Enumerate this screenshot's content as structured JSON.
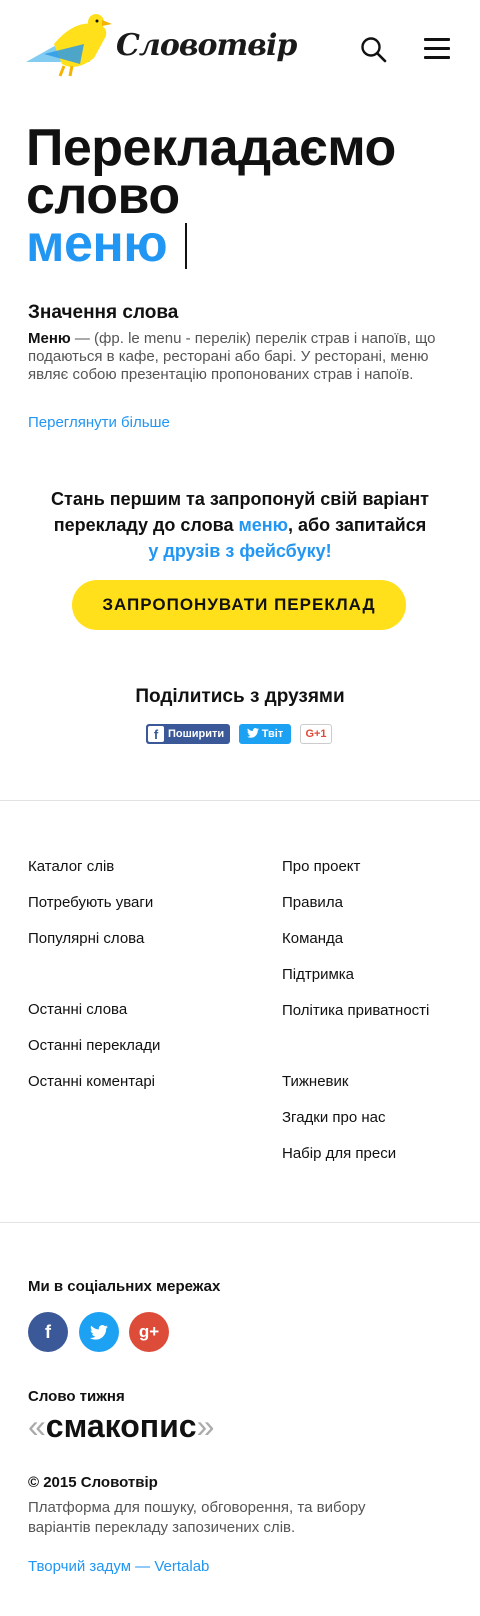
{
  "header": {
    "logo_text": "Словотвір",
    "colors": {
      "bird_blue": "#74c6f0",
      "bird_yellow": "#ffe01a",
      "bird_deep_blue": "#2e9be6"
    }
  },
  "hero": {
    "title_line1": "Перекладаємо",
    "title_line2": "слово",
    "word": "меню"
  },
  "meaning": {
    "heading": "Значення слова",
    "term": "Меню",
    "definition": " — (фр. le menu - перелік) перелік страв і напоїв, що подаються в кафе, ресторані або барі. У ресторані, меню являє собою презентацію пропонованих страв і напоїв.",
    "more_link": "Переглянути більше"
  },
  "cta": {
    "text_part1": "Стань першим та запропонуй свій варіант перекладу до слова ",
    "word": "меню",
    "text_part2": ", або запитайся ",
    "facebook_link": "у друзів з фейсбуку!",
    "button": "ЗАПРОПОНУВАТИ ПЕРЕКЛАД"
  },
  "share": {
    "heading": "Поділитись з друзями",
    "fb_label": "Поширити",
    "fb_glyph": "f",
    "tw_label": "Твіт",
    "gp_label": "G+1"
  },
  "footer": {
    "left_links": [
      "Каталог слів",
      "Потребують уваги",
      "Популярні слова",
      "Останні слова",
      "Останні переклади",
      "Останні коментарі"
    ],
    "right_links": [
      "Про проект",
      "Правила",
      "Команда",
      "Підтримка",
      "Політика приватності",
      "Тижневик",
      "Згадки про нас",
      "Набір для преси"
    ],
    "social_heading": "Ми в соціальних мережах",
    "social_glyphs": {
      "facebook": "f",
      "google": "g+"
    },
    "word_of_week_heading": "Слово тижня",
    "word_of_week": "смакопис",
    "copyright": "© 2015 Словотвір",
    "tagline": "Платформа для пошуку, обговорення, та вибору варіантів перекладу запозичених слів.",
    "credit": "Творчий задум — Vertalab"
  },
  "accent_colors": {
    "blue": "#2196f3",
    "yellow": "#ffe01a",
    "facebook": "#3b5998",
    "twitter": "#1da1f2",
    "google": "#dd4b39"
  }
}
